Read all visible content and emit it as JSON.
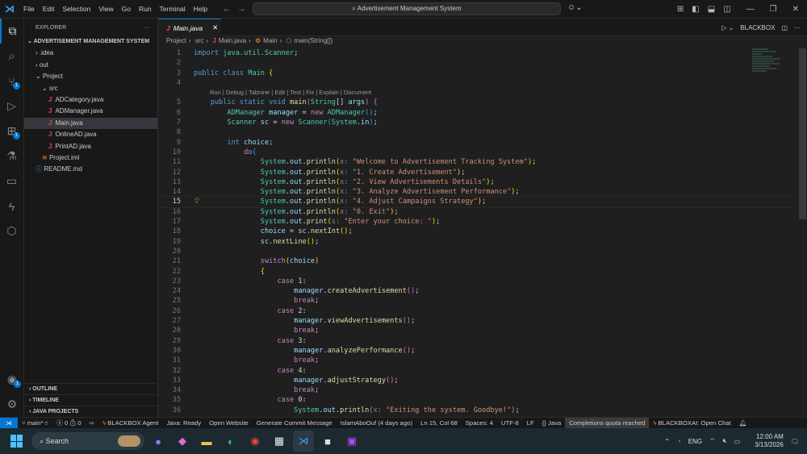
{
  "titlebar": {
    "menu": [
      "File",
      "Edit",
      "Selection",
      "View",
      "Go",
      "Run",
      "Terminal",
      "Help"
    ],
    "search": "Advertisement Management System"
  },
  "sidebar": {
    "title": "EXPLORER",
    "more": "···",
    "root": "ADVERTISEMENT MANAGEMENT SYSTEM",
    "items": [
      {
        "label": ".idea",
        "type": "folder",
        "depth": 1,
        "open": false
      },
      {
        "label": "out",
        "type": "folder",
        "depth": 1,
        "open": false
      },
      {
        "label": "Project",
        "type": "folder",
        "depth": 1,
        "open": true
      },
      {
        "label": "src",
        "type": "folder",
        "depth": 2,
        "open": true
      },
      {
        "label": "ADCategory.java",
        "type": "java",
        "depth": 3
      },
      {
        "label": "ADManager.java",
        "type": "java",
        "depth": 3
      },
      {
        "label": "Main.java",
        "type": "java",
        "depth": 3,
        "selected": true
      },
      {
        "label": "OnlineAD.java",
        "type": "java",
        "depth": 3
      },
      {
        "label": "PrintAD.java",
        "type": "java",
        "depth": 3
      },
      {
        "label": "Project.iml",
        "type": "iml",
        "depth": 2
      },
      {
        "label": "README.md",
        "type": "md",
        "depth": 1
      }
    ],
    "sections": [
      "OUTLINE",
      "TIMELINE",
      "JAVA PROJECTS"
    ],
    "badges": {
      "scm": "1",
      "extensions": "1",
      "accounts": "1"
    }
  },
  "editor": {
    "tab": "Main.java",
    "run": "▷",
    "blackbox": "BLACKBOX",
    "breadcrumbs": [
      "Project",
      "src",
      "Main.java",
      "Main",
      "main(String[])"
    ],
    "codelens": "Run | Debug | Tabnine | Edit | Test | Fix | Explain | Document",
    "current_line": 15,
    "lines": [
      [
        [
          "import ",
          "kw"
        ],
        [
          "java.util.Scanner",
          "ty"
        ],
        [
          ";",
          "pl"
        ]
      ],
      [],
      [
        [
          "public class ",
          "kw"
        ],
        [
          "Main ",
          "ty"
        ],
        [
          "{",
          "br"
        ]
      ],
      [],
      [
        [
          "    public static void ",
          "kw"
        ],
        [
          "main",
          "fn"
        ],
        [
          "(",
          "br2"
        ],
        [
          "String",
          "ty"
        ],
        [
          "[] ",
          "pl"
        ],
        [
          "args",
          "va"
        ],
        [
          ") ",
          "br2"
        ],
        [
          "{",
          "br2"
        ]
      ],
      [
        [
          "        ADManager ",
          "ty"
        ],
        [
          "manager",
          "va"
        ],
        [
          " = ",
          "pl"
        ],
        [
          "new ",
          "ct"
        ],
        [
          "ADManager",
          "ty"
        ],
        [
          "()",
          "br3"
        ],
        [
          ";",
          "pl"
        ]
      ],
      [
        [
          "        Scanner ",
          "ty"
        ],
        [
          "sc",
          "va"
        ],
        [
          " = ",
          "pl"
        ],
        [
          "new ",
          "ct"
        ],
        [
          "Scanner",
          "ty"
        ],
        [
          "(",
          "br3"
        ],
        [
          "System",
          "ty"
        ],
        [
          ".",
          "pl"
        ],
        [
          "in",
          "va"
        ],
        [
          ")",
          "br3"
        ],
        [
          ";",
          "pl"
        ]
      ],
      [],
      [
        [
          "        int ",
          "kw"
        ],
        [
          "choice",
          "va"
        ],
        [
          ";",
          "pl"
        ]
      ],
      [
        [
          "            do",
          "ct"
        ],
        [
          "{",
          "br3"
        ]
      ],
      [
        [
          "                System",
          "ty"
        ],
        [
          ".",
          "pl"
        ],
        [
          "out",
          "va"
        ],
        [
          ".",
          "pl"
        ],
        [
          "println",
          "fn"
        ],
        [
          "(",
          "br"
        ],
        [
          "x: ",
          "hint"
        ],
        [
          "\"Welcome to Advertisement Tracking System\"",
          "st"
        ],
        [
          ")",
          "br"
        ],
        [
          ";",
          "pl"
        ]
      ],
      [
        [
          "                System",
          "ty"
        ],
        [
          ".",
          "pl"
        ],
        [
          "out",
          "va"
        ],
        [
          ".",
          "pl"
        ],
        [
          "println",
          "fn"
        ],
        [
          "(",
          "br"
        ],
        [
          "x: ",
          "hint"
        ],
        [
          "\"1. Create Advertisement\"",
          "st"
        ],
        [
          ")",
          "br"
        ],
        [
          ";",
          "pl"
        ]
      ],
      [
        [
          "                System",
          "ty"
        ],
        [
          ".",
          "pl"
        ],
        [
          "out",
          "va"
        ],
        [
          ".",
          "pl"
        ],
        [
          "println",
          "fn"
        ],
        [
          "(",
          "br"
        ],
        [
          "x: ",
          "hint"
        ],
        [
          "\"2. View Advertisements Details\"",
          "st"
        ],
        [
          ")",
          "br"
        ],
        [
          ";",
          "pl"
        ]
      ],
      [
        [
          "                System",
          "ty"
        ],
        [
          ".",
          "pl"
        ],
        [
          "out",
          "va"
        ],
        [
          ".",
          "pl"
        ],
        [
          "println",
          "fn"
        ],
        [
          "(",
          "br"
        ],
        [
          "x: ",
          "hint"
        ],
        [
          "\"3. Analyze Advertisement Performance\"",
          "st"
        ],
        [
          ")",
          "br"
        ],
        [
          ";",
          "pl"
        ]
      ],
      [
        [
          "                System",
          "ty"
        ],
        [
          ".",
          "pl"
        ],
        [
          "out",
          "va"
        ],
        [
          ".",
          "pl"
        ],
        [
          "println",
          "fn"
        ],
        [
          "(",
          "br"
        ],
        [
          "x: ",
          "hint"
        ],
        [
          "\"4. Adjust Campaigns Strategy\"",
          "st"
        ],
        [
          ")",
          "br"
        ],
        [
          ";",
          "pl"
        ]
      ],
      [
        [
          "                System",
          "ty"
        ],
        [
          ".",
          "pl"
        ],
        [
          "out",
          "va"
        ],
        [
          ".",
          "pl"
        ],
        [
          "println",
          "fn"
        ],
        [
          "(",
          "br"
        ],
        [
          "x: ",
          "hint"
        ],
        [
          "\"0. Exit\"",
          "st"
        ],
        [
          ")",
          "br"
        ],
        [
          ";",
          "pl"
        ]
      ],
      [
        [
          "                System",
          "ty"
        ],
        [
          ".",
          "pl"
        ],
        [
          "out",
          "va"
        ],
        [
          ".",
          "pl"
        ],
        [
          "print",
          "fn"
        ],
        [
          "(",
          "br"
        ],
        [
          "s: ",
          "hint"
        ],
        [
          "\"Enter your choice: \"",
          "st"
        ],
        [
          ")",
          "br"
        ],
        [
          ";",
          "pl"
        ]
      ],
      [
        [
          "                choice",
          "va"
        ],
        [
          " = ",
          "pl"
        ],
        [
          "sc",
          "va"
        ],
        [
          ".",
          "pl"
        ],
        [
          "nextInt",
          "fn"
        ],
        [
          "()",
          "br"
        ],
        [
          ";",
          "pl"
        ]
      ],
      [
        [
          "                sc",
          "va"
        ],
        [
          ".",
          "pl"
        ],
        [
          "nextLine",
          "fn"
        ],
        [
          "()",
          "br"
        ],
        [
          ";",
          "pl"
        ]
      ],
      [],
      [
        [
          "                switch",
          "ct"
        ],
        [
          "(",
          "br"
        ],
        [
          "choice",
          "va"
        ],
        [
          ")",
          "br"
        ]
      ],
      [
        [
          "                {",
          "br"
        ]
      ],
      [
        [
          "                    case ",
          "ct"
        ],
        [
          "1",
          "pl"
        ],
        [
          ":",
          "pl"
        ]
      ],
      [
        [
          "                        manager",
          "va"
        ],
        [
          ".",
          "pl"
        ],
        [
          "createAdvertisement",
          "fn"
        ],
        [
          "()",
          "br2"
        ],
        [
          ";",
          "pl"
        ]
      ],
      [
        [
          "                        break",
          "ct"
        ],
        [
          ";",
          "pl"
        ]
      ],
      [
        [
          "                    case ",
          "ct"
        ],
        [
          "2",
          "pl"
        ],
        [
          ":",
          "pl"
        ]
      ],
      [
        [
          "                        manager",
          "va"
        ],
        [
          ".",
          "pl"
        ],
        [
          "viewAdvertisements",
          "fn"
        ],
        [
          "()",
          "br2"
        ],
        [
          ";",
          "pl"
        ]
      ],
      [
        [
          "                        break",
          "ct"
        ],
        [
          ";",
          "pl"
        ]
      ],
      [
        [
          "                    case ",
          "ct"
        ],
        [
          "3",
          "pl"
        ],
        [
          ":",
          "pl"
        ]
      ],
      [
        [
          "                        manager",
          "va"
        ],
        [
          ".",
          "pl"
        ],
        [
          "analyzePerformance",
          "fn"
        ],
        [
          "()",
          "br2"
        ],
        [
          ";",
          "pl"
        ]
      ],
      [
        [
          "                        break",
          "ct"
        ],
        [
          ";",
          "pl"
        ]
      ],
      [
        [
          "                    case ",
          "ct"
        ],
        [
          "4",
          "pl"
        ],
        [
          ":",
          "pl"
        ]
      ],
      [
        [
          "                        manager",
          "va"
        ],
        [
          ".",
          "pl"
        ],
        [
          "adjustStrategy",
          "fn"
        ],
        [
          "()",
          "br2"
        ],
        [
          ";",
          "pl"
        ]
      ],
      [
        [
          "                        break",
          "ct"
        ],
        [
          ";",
          "pl"
        ]
      ],
      [
        [
          "                    case ",
          "ct"
        ],
        [
          "0",
          "pl"
        ],
        [
          ":",
          "pl"
        ]
      ],
      [
        [
          "                        System",
          "ty"
        ],
        [
          ".",
          "pl"
        ],
        [
          "out",
          "va"
        ],
        [
          ".",
          "pl"
        ],
        [
          "println",
          "fn"
        ],
        [
          "(",
          "br2"
        ],
        [
          "x: ",
          "hint"
        ],
        [
          "\"Exiting the system. Goodbye!\"",
          "st"
        ],
        [
          ")",
          "br2"
        ],
        [
          ";",
          "pl"
        ]
      ]
    ]
  },
  "status": {
    "branch": "main*",
    "errors": "0",
    "warnings": "0",
    "blackbox_agent": "BLACKBOX Agent",
    "java": "Java: Ready",
    "open_website": "Open Website",
    "commit": "Generate Commit Message",
    "blame": "IslamAboOuf (4 days ago)",
    "position": "Ln 15, Col 68",
    "spaces": "Spaces: 4",
    "encoding": "UTF-8",
    "eol": "LF",
    "language": "Java",
    "quota": "Completions quota reached",
    "blackbox_chat": "BLACKBOXAI: Open Chat"
  },
  "taskbar": {
    "search": "Search",
    "lang": "ENG",
    "time": "12:00 AM",
    "date": "3/13/2026"
  }
}
